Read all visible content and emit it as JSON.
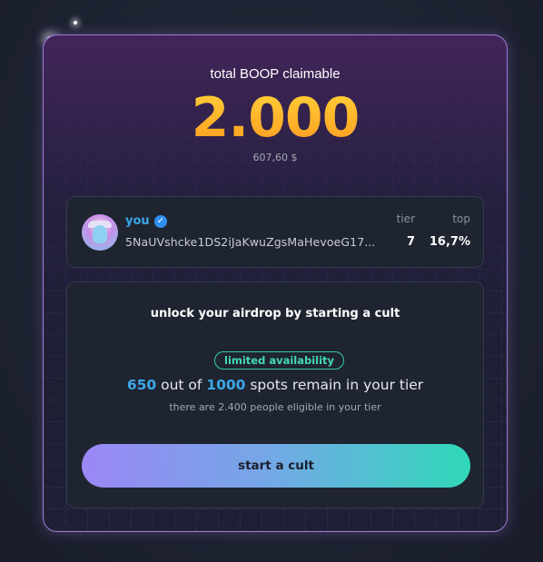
{
  "claim": {
    "label": "total BOOP claimable",
    "amount": "2.000",
    "usd": "607,60 $"
  },
  "user": {
    "name": "you",
    "verified_icon": "verified-checkmark-icon",
    "wallet": "5NaUVshcke1DS2iJaKwuZgsMaHevoeG17...",
    "tier_label": "tier",
    "tier_value": "7",
    "top_label": "top",
    "top_value": "16,7%"
  },
  "cult": {
    "title": "unlock your airdrop by starting a cult",
    "badge": "limited availability",
    "spots_remaining": "650",
    "spots_mid": " out of ",
    "spots_total": "1000",
    "spots_suffix": " spots remain in your tier",
    "eligible_text": "there are 2.400 people eligible in your tier",
    "button_label": "start a cult"
  },
  "colors": {
    "accent_blue": "#3aa7e8",
    "accent_teal": "#2fd8b8",
    "accent_purple": "#9b87f5",
    "amount_orange": "#ff9a1e",
    "card_border": "#9d7ad6"
  }
}
